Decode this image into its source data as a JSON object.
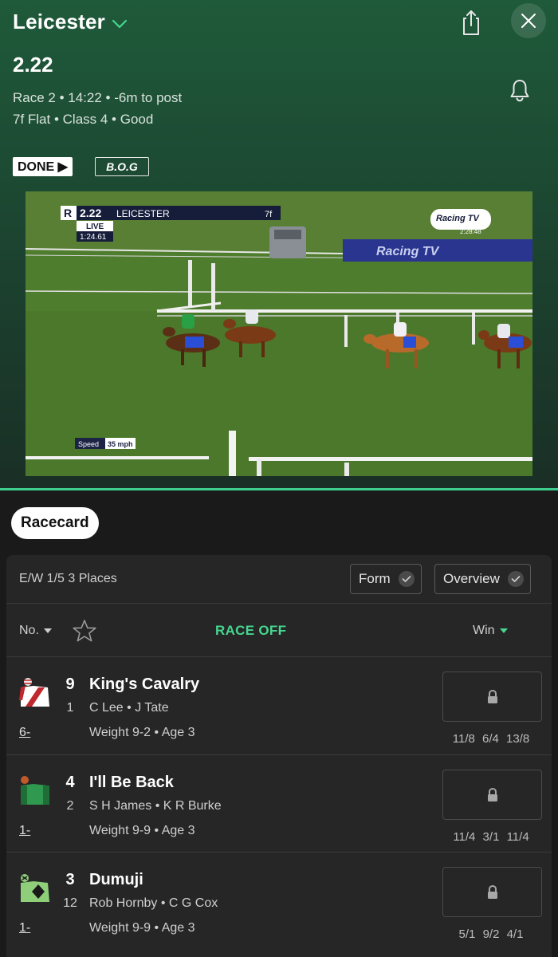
{
  "header": {
    "venue": "Leicester",
    "race_time": "2.22",
    "meta_line1": "Race 2 • 14:22 • -6m to post",
    "meta_line2": "7f Flat  • Class 4  • Good",
    "badge_done": "DONE ▶",
    "badge_bog": "B.O.G"
  },
  "video": {
    "overlay_time": "2.22",
    "overlay_venue": "LEICESTER",
    "overlay_distance": "7f",
    "overlay_live": "LIVE",
    "overlay_clock": "1:24.61",
    "channel_logo": "Racing TV",
    "channel_clock": "2:28:48",
    "speed_label": "Speed",
    "speed_value": "35 mph",
    "board_text": "Racing TV"
  },
  "tabs": {
    "racecard": "Racecard"
  },
  "card": {
    "ew_terms": "E/W 1/5 3 Places",
    "form_toggle": "Form",
    "overview_toggle": "Overview",
    "col_no": "No.",
    "race_status": "RACE OFF",
    "col_win": "Win"
  },
  "runners": [
    {
      "number": "9",
      "name": "King's Cavalry",
      "draw": "1",
      "jockey_trainer": "C Lee • J Tate",
      "form": "6-",
      "weight_age": "Weight 9-2 • Age 3",
      "prices": "11/8 6/4 13/8"
    },
    {
      "number": "4",
      "name": "I'll Be Back",
      "draw": "2",
      "jockey_trainer": "S H James • K R Burke",
      "form": "1-",
      "weight_age": "Weight 9-9 • Age 3",
      "prices": "11/4 3/1 11/4"
    },
    {
      "number": "3",
      "name": "Dumuji",
      "draw": "12",
      "jockey_trainer": "Rob Hornby • C G Cox",
      "form": "1-",
      "weight_age": "Weight 9-9 • Age 3",
      "prices": "5/1 9/2 4/1"
    }
  ],
  "colors": {
    "accent_green": "#46d68f",
    "divider_green": "#3ecf8e",
    "card_bg": "#262626",
    "header_green": "#1f5a3a"
  },
  "icons": {
    "venue_dropdown": "chevron-down-icon",
    "share": "share-icon",
    "close": "close-icon",
    "alert": "bell-icon",
    "favourite": "star-icon",
    "locked_odds": "lock-icon",
    "toggle_on": "check-icon"
  }
}
